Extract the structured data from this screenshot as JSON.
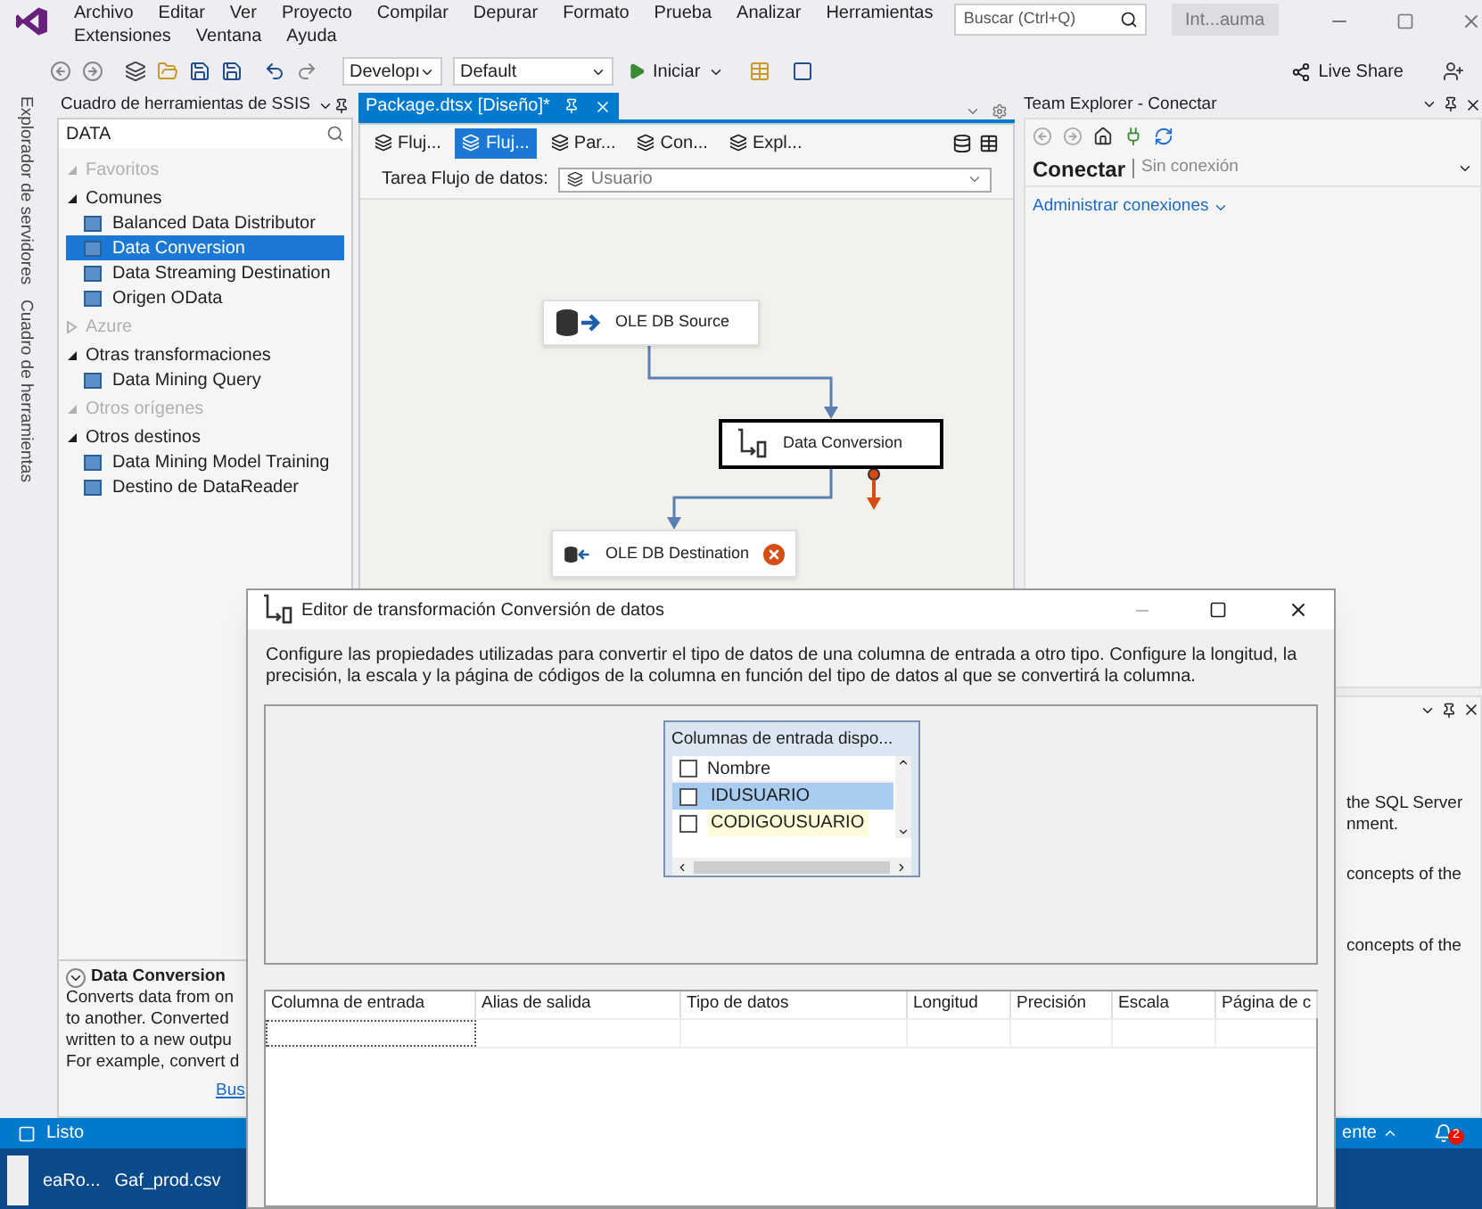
{
  "menu": {
    "items": [
      "Archivo",
      "Editar",
      "Ver",
      "Proyecto",
      "Compilar",
      "Depurar",
      "Formato",
      "Prueba",
      "Analizar",
      "Herramientas",
      "Extensiones",
      "Ventana",
      "Ayuda"
    ],
    "search": {
      "placeholder": "Buscar (Ctrl+Q)"
    },
    "account": "Int...auma"
  },
  "toolbar": {
    "configuration": "Developı",
    "platform": "Default",
    "start": "Iniciar",
    "live_share": "Live Share"
  },
  "side_tabs": [
    "Explorador de servidores",
    "Cuadro de herramientas"
  ],
  "toolbox": {
    "title": "Cuadro de herramientas de SSIS",
    "search": "DATA",
    "groups": [
      {
        "label": "Favoritos",
        "expanded": true,
        "empty": true
      },
      {
        "label": "Comunes",
        "expanded": true,
        "empty": false,
        "items": [
          {
            "label": "Balanced Data Distributor",
            "selected": false
          },
          {
            "label": "Data Conversion",
            "selected": true
          },
          {
            "label": "Data Streaming Destination",
            "selected": false
          },
          {
            "label": "Origen OData",
            "selected": false
          }
        ]
      },
      {
        "label": "Azure",
        "expanded": false,
        "empty": true
      },
      {
        "label": "Otras transformaciones",
        "expanded": true,
        "empty": false,
        "items": [
          {
            "label": "Data Mining Query",
            "selected": false
          }
        ]
      },
      {
        "label": "Otros orígenes",
        "expanded": true,
        "empty": true
      },
      {
        "label": "Otros destinos",
        "expanded": true,
        "empty": false,
        "items": [
          {
            "label": "Data Mining Model Training",
            "selected": false
          },
          {
            "label": "Destino de DataReader",
            "selected": false
          }
        ]
      }
    ]
  },
  "info": {
    "title": "Data Conversion",
    "lines": [
      "Converts data from on",
      "to another. Converted",
      "written to a new outpu",
      "For example, convert d"
    ],
    "link": "Bus"
  },
  "designer": {
    "tab": "Package.dtsx [Diseño]*",
    "views": [
      {
        "label": "Fluj...",
        "selected": false
      },
      {
        "label": "Fluj...",
        "selected": true
      },
      {
        "label": "Par...",
        "selected": false
      },
      {
        "label": "Con...",
        "selected": false
      },
      {
        "label": "Expl...",
        "selected": false
      }
    ],
    "task_label": "Tarea Flujo de datos:",
    "task_value": "Usuario",
    "nodes": [
      {
        "label": "OLE DB Source",
        "kind": "source",
        "selected": false,
        "error": false
      },
      {
        "label": "Data Conversion",
        "kind": "transform",
        "selected": true,
        "error": false
      },
      {
        "label": "OLE DB Destination",
        "kind": "destination",
        "selected": false,
        "error": true
      }
    ]
  },
  "team_explorer": {
    "title": "Team Explorer - Conectar",
    "heading": "Conectar",
    "status": "Sin conexión",
    "link": "Administrar conexiones"
  },
  "lower_panel": {
    "lines": [
      "the SQL Server",
      "nment.",
      "concepts of the",
      "concepts of the"
    ]
  },
  "status_bar": {
    "text": "Listo",
    "right": "ente",
    "notifications": "2"
  },
  "taskbar": {
    "items": [
      "eaRo...",
      "Gaf_prod.csv"
    ]
  },
  "dialog": {
    "title": "Editor de transformación Conversión de datos",
    "description": "Configure las propiedades utilizadas para convertir el tipo de datos de una columna de entrada a otro tipo. Configure la longitud, la precisión, la escala y la página de códigos de la columna en función del tipo de datos al que se convertirá la columna.",
    "available": {
      "title": "Columnas de entrada dispo...",
      "header": "Nombre",
      "header_checked": false,
      "rows": [
        {
          "name": "IDUSUARIO",
          "checked": false,
          "selected": true,
          "hovered": false
        },
        {
          "name": "CODIGOUSUARIO",
          "checked": false,
          "selected": false,
          "hovered": true
        }
      ]
    },
    "grid": {
      "columns": [
        "Columna de entrada",
        "Alias de salida",
        "Tipo de datos",
        "Longitud",
        "Precisión",
        "Escala",
        "Página de c"
      ]
    }
  }
}
